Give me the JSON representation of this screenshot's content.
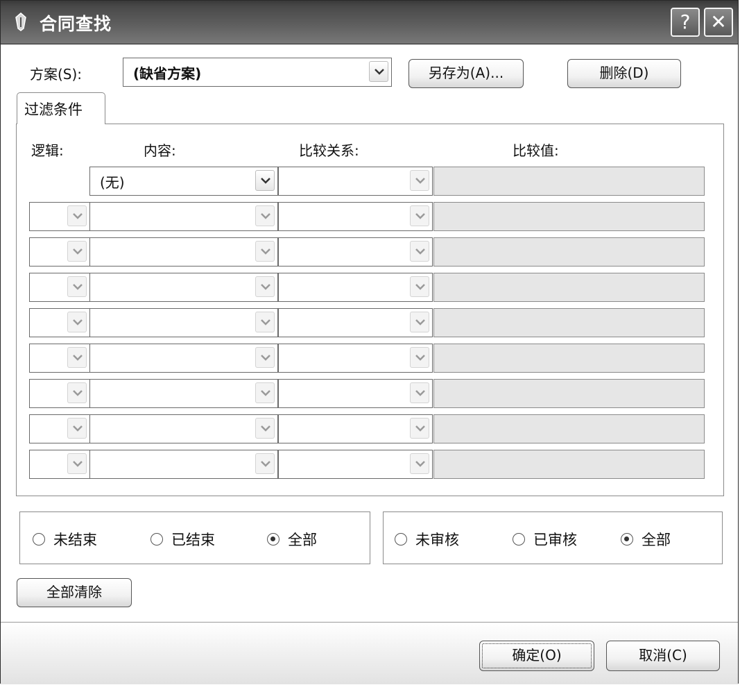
{
  "window": {
    "title": "合同查找",
    "help_label": "?",
    "close_label": "✕"
  },
  "scheme": {
    "label": "方案(S):",
    "value": "(缺省方案)",
    "save_as_label": "另存为(A)...",
    "delete_label": "删除(D)"
  },
  "filter_tab": {
    "label": "过滤条件"
  },
  "columns": {
    "logic": "逻辑:",
    "content": "内容:",
    "relation": "比较关系:",
    "value": "比较值:"
  },
  "rows": [
    {
      "logic": "",
      "content": "(无)",
      "relation": "",
      "value": ""
    },
    {
      "logic": "",
      "content": "",
      "relation": "",
      "value": ""
    },
    {
      "logic": "",
      "content": "",
      "relation": "",
      "value": ""
    },
    {
      "logic": "",
      "content": "",
      "relation": "",
      "value": ""
    },
    {
      "logic": "",
      "content": "",
      "relation": "",
      "value": ""
    },
    {
      "logic": "",
      "content": "",
      "relation": "",
      "value": ""
    },
    {
      "logic": "",
      "content": "",
      "relation": "",
      "value": ""
    },
    {
      "logic": "",
      "content": "",
      "relation": "",
      "value": ""
    },
    {
      "logic": "",
      "content": "",
      "relation": "",
      "value": ""
    }
  ],
  "status_group": {
    "options": [
      "未结束",
      "已结束",
      "全部"
    ],
    "selected": "全部"
  },
  "audit_group": {
    "options": [
      "未审核",
      "已审核",
      "全部"
    ],
    "selected": "全部"
  },
  "clear_all_label": "全部清除",
  "ok_label": "确定(O)",
  "cancel_label": "取消(C)",
  "icons": {
    "app": "contract-app-icon",
    "dropdown": "chevron-down-icon"
  }
}
